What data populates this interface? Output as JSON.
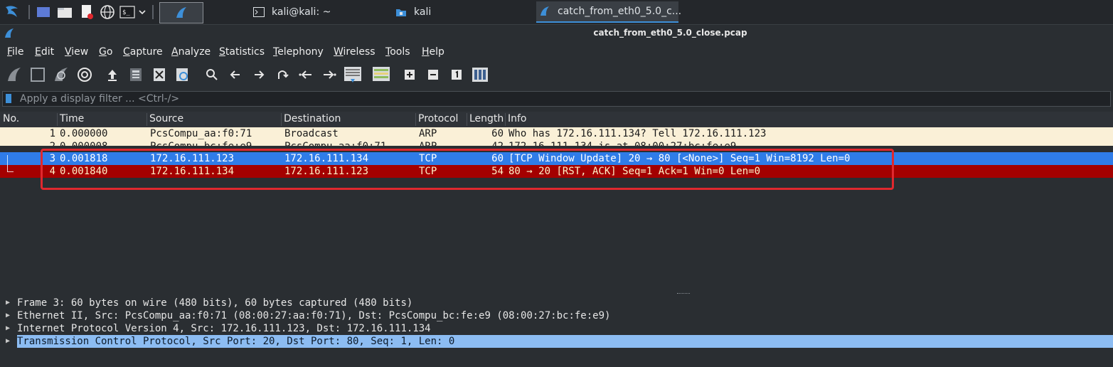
{
  "taskbar": {
    "tasks": [
      {
        "label": "kali@kali: ~",
        "icon": "terminal-icon"
      },
      {
        "label": "kali",
        "icon": "folder-icon"
      },
      {
        "label": "catch_from_eth0_5.0_c...",
        "icon": "wireshark-icon"
      }
    ]
  },
  "window": {
    "title": "catch_from_eth0_5.0_close.pcap"
  },
  "menu": [
    "File",
    "Edit",
    "View",
    "Go",
    "Capture",
    "Analyze",
    "Statistics",
    "Telephony",
    "Wireless",
    "Tools",
    "Help"
  ],
  "filter": {
    "placeholder": "Apply a display filter ... <Ctrl-/>"
  },
  "packet_list": {
    "columns": [
      "No.",
      "Time",
      "Source",
      "Destination",
      "Protocol",
      "Length",
      "Info"
    ],
    "rows": [
      {
        "no": "1",
        "time": "0.000000",
        "source": "PcsCompu_aa:f0:71",
        "destination": "Broadcast",
        "protocol": "ARP",
        "length": "60",
        "info": "Who has 172.16.111.134? Tell 172.16.111.123"
      },
      {
        "no": "2",
        "time": "0.000008",
        "source": "PcsCompu_bc:fe:e9",
        "destination": "PcsCompu_aa:f0:71",
        "protocol": "ARP",
        "length": "42",
        "info": "172.16.111.134 is at 08:00:27:bc:fe:e9"
      },
      {
        "no": "3",
        "time": "0.001818",
        "source": "172.16.111.123",
        "destination": "172.16.111.134",
        "protocol": "TCP",
        "length": "60",
        "info": "[TCP Window Update] 20 → 80 [<None>] Seq=1 Win=8192 Len=0"
      },
      {
        "no": "4",
        "time": "0.001840",
        "source": "172.16.111.134",
        "destination": "172.16.111.123",
        "protocol": "TCP",
        "length": "54",
        "info": "80 → 20 [RST, ACK] Seq=1 Ack=1 Win=0 Len=0"
      }
    ]
  },
  "details": [
    "Frame 3: 60 bytes on wire (480 bits), 60 bytes captured (480 bits)",
    "Ethernet II, Src: PcsCompu_aa:f0:71 (08:00:27:aa:f0:71), Dst: PcsCompu_bc:fe:e9 (08:00:27:bc:fe:e9)",
    "Internet Protocol Version 4, Src: 172.16.111.123, Dst: 172.16.111.134",
    "Transmission Control Protocol, Src Port: 20, Dst Port: 80, Seq: 1, Len: 0"
  ],
  "colors": {
    "arp_row": "#faf0d7",
    "selected_row": "#2f7ce8",
    "rst_row": "#a40000",
    "detail_selected": "#8cbcf2",
    "annotation_box": "#e0282e"
  }
}
